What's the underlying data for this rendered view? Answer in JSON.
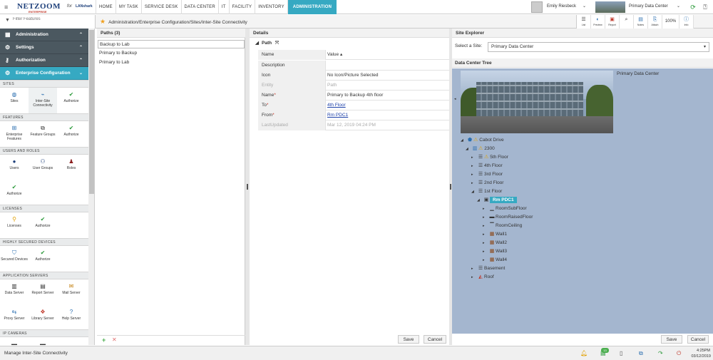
{
  "header": {
    "logo_brand": "NETZOOM",
    "logo_sub": "ENTERPRISE",
    "logo_for": "for",
    "logo_partner": "LANshark",
    "nav_tabs": [
      "HOME",
      "MY TASK",
      "SERVICE DESK",
      "DATA CENTER",
      "IT",
      "FACILITY",
      "INVENTORY",
      "ADMINISTRATION"
    ],
    "active_tab": "ADMINISTRATION",
    "user_name": "Emily Riesbeck",
    "site_name": "Primary Data Center"
  },
  "filter": {
    "placeholder": "Filter Features"
  },
  "breadcrumb": "Administration/Enterprise Configuration/Sites/Inter-Site Connectivity",
  "toolbar": {
    "list": "List",
    "preview": "Preview",
    "report": "Report",
    "notes": "Notes",
    "attach": "Attach",
    "zoom": "100%",
    "info": "Info"
  },
  "sidebar": {
    "accordions": [
      {
        "label": "Administration",
        "icon": "grid-icon"
      },
      {
        "label": "Settings",
        "icon": "sliders-icon"
      },
      {
        "label": "Authorization",
        "icon": "key-icon"
      },
      {
        "label": "Enterprise Configuration",
        "icon": "gear-icon"
      }
    ],
    "sections": {
      "sites": "SITES",
      "features": "FEATURES",
      "users": "USERS AND ROLES",
      "licenses": "LICENSES",
      "secured": "HIGHLY SECURED DEVICES",
      "appservers": "APPLICATION SERVERS",
      "ipcameras": "IP CAMERAS"
    },
    "items": {
      "sites": "Sites",
      "intersite": "Inter-Site Connectivity",
      "authorize": "Authorize",
      "enterprise_features": "Enterprise Features",
      "feature_groups": "Feature Groups",
      "users": "Users",
      "user_groups": "User Groups",
      "roles": "Roles",
      "licenses": "Licenses",
      "secured_devices": "Secured Devices",
      "data_server": "Data Server",
      "report_server": "Report Server",
      "mail_server": "Mail Server",
      "proxy_server": "Proxy Server",
      "library_server": "Library Server",
      "help_server": "Help Server"
    }
  },
  "paths": {
    "title": "Paths (3)",
    "rows": [
      "Backup to Lab",
      "Primary to Backup",
      "Primary to Lab"
    ]
  },
  "details": {
    "title": "Details",
    "subtitle": "Path",
    "col_name": "Name",
    "col_value": "Value",
    "rows": [
      {
        "key": "Description",
        "value": ""
      },
      {
        "key": "Icon",
        "value": "No Icon/Picture Selected"
      },
      {
        "key": "Entity",
        "value": "Path"
      },
      {
        "key": "Name",
        "value": "Primary to Backup 4th floor"
      },
      {
        "key": "To",
        "value": "4th Floor"
      },
      {
        "key": "From",
        "value": "Rm PDC1"
      },
      {
        "key": "LastUpdated",
        "value": "Mar 12, 2019 04:24 PM"
      }
    ],
    "save": "Save",
    "cancel": "Cancel"
  },
  "explorer": {
    "title": "Site Explorer",
    "select_label": "Select a Site:",
    "select_value": "Primary Data Center",
    "tree_title": "Data Center Tree",
    "photo_caption": "Primary Data Center",
    "nodes": {
      "cabot": "Cabot Drive",
      "b2300": "2300",
      "f5": "5th Floor",
      "f4": "4th Floor",
      "f3": "3rd Floor",
      "f2": "2nd Floor",
      "f1": "1st Floor",
      "rm": "Rm PDC1",
      "subfloor": "RoomSubFloor",
      "raised": "RoomRaisedFloor",
      "ceiling": "RoomCeiling",
      "wall1": "Wall1",
      "wall2": "Wall2",
      "wall3": "Wall3",
      "wall4": "Wall4",
      "basement": "Basement",
      "roof": "Roof"
    },
    "save": "Save",
    "cancel": "Cancel"
  },
  "status": {
    "message": "Manage Inter-Site Connectivity",
    "badge": "13",
    "time": "4:25PM",
    "date": "03/12/2019"
  },
  "colors": {
    "accent": "#36a9c2",
    "sidebar_dark": "#4b5860",
    "tree_bg": "#a4b6cf"
  }
}
